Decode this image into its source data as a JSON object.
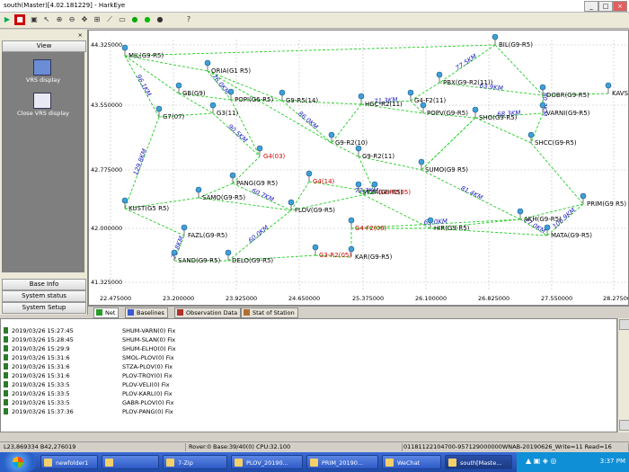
{
  "window": {
    "title": "south(Master)[4.02.181229] - HarkEye"
  },
  "toolbar": {
    "buttons": [
      "play",
      "stop",
      "save",
      "pointer",
      "zoom-in",
      "zoom-out",
      "pan",
      "select",
      "line",
      "open",
      "dot-green",
      "dot-green2",
      "dot-black",
      "help"
    ]
  },
  "left_panel": {
    "header": "View",
    "items": [
      {
        "label": "VRS display",
        "icon": "vrs-display-icon"
      },
      {
        "label": "Close VRS display",
        "icon": "close-vrs-icon"
      }
    ],
    "bottom_buttons": [
      "Base Info",
      "System status",
      "System Setup"
    ]
  },
  "map": {
    "y_ticks": [
      "44.325000",
      "43.550000",
      "42.775000",
      "42.000000",
      "41.325000"
    ],
    "x_ticks": [
      "22.475000",
      "23.200000",
      "23.925000",
      "24.650000",
      "25.375000",
      "26.100000",
      "26.825000",
      "27.550000",
      "28.275000"
    ],
    "stations": [
      {
        "name": "MIL(G9-R5)",
        "color": "#000000"
      },
      {
        "name": "BIL(G9-R5)",
        "color": "#000000"
      },
      {
        "name": "ORIA(G1 R5)",
        "color": "#000000"
      },
      {
        "name": "GB(G9)",
        "color": "#000000"
      },
      {
        "name": "POPI(G6-R5)",
        "color": "#000000"
      },
      {
        "name": "G9-R5(14)",
        "color": "#000000"
      },
      {
        "name": "HGC-R2(11)",
        "color": "#000000"
      },
      {
        "name": "G4-F2(11)",
        "color": "#000000"
      },
      {
        "name": "PBX(G9-R2(11))",
        "color": "#000000"
      },
      {
        "name": "DOBR(G9-R5)",
        "color": "#000000"
      },
      {
        "name": "KAVS(G9)",
        "color": "#000000"
      },
      {
        "name": "POPV(G9-R5)",
        "color": "#000000"
      },
      {
        "name": "SHO(G9-R5)",
        "color": "#000000"
      },
      {
        "name": "VARNI(G9-R5)",
        "color": "#000000"
      },
      {
        "name": "G7(07)",
        "color": "#000000"
      },
      {
        "name": "G3(11)",
        "color": "#000000"
      },
      {
        "name": "G4(03)",
        "color": "#cc0000"
      },
      {
        "name": "G4(14)",
        "color": "#cc0000"
      },
      {
        "name": "G4-R2(05)",
        "color": "#cc0000"
      },
      {
        "name": "G4-F2(06)",
        "color": "#cc0000"
      },
      {
        "name": "G3-R2(05)",
        "color": "#cc0000"
      },
      {
        "name": "PANG(G9 R5)",
        "color": "#000000"
      },
      {
        "name": "SAMO(G9-R5)",
        "color": "#000000"
      },
      {
        "name": "KUST(G5 R5)",
        "color": "#000000"
      },
      {
        "name": "FLOV(G9-R5)",
        "color": "#000000"
      },
      {
        "name": "STZA(G9 R5)",
        "color": "#000000"
      },
      {
        "name": "SUMO(G9 R5)",
        "color": "#000000"
      },
      {
        "name": "HIR(G9-R5)",
        "color": "#000000"
      },
      {
        "name": "AKH(G9-R5)",
        "color": "#000000"
      },
      {
        "name": "PRIM(G9 R5)",
        "color": "#000000"
      },
      {
        "name": "MATA(G9-R5)",
        "color": "#000000"
      },
      {
        "name": "FAZL(G9-R5)",
        "color": "#000000"
      },
      {
        "name": "SAND(G9-R5)",
        "color": "#000000"
      },
      {
        "name": "DELO(G9-R5)",
        "color": "#000000"
      },
      {
        "name": "KAR(G9-R5)",
        "color": "#000000"
      },
      {
        "name": "G9-R2(11)",
        "color": "#000000"
      },
      {
        "name": "G9-R2(10)",
        "color": "#000000"
      },
      {
        "name": "SHCC(G9-R5)",
        "color": "#000000"
      }
    ],
    "distances": [
      "77.5KM",
      "96.1KM",
      "129.8KM",
      "76.0KM",
      "86.0KM",
      "71.3KM",
      "63.9KM",
      "80.3KM",
      "68.3KM",
      "106.9KM",
      "77.0KM",
      "81.4KM",
      "72.2KM",
      "65.0KM",
      "90.5KM",
      "60.0KM",
      "72.8KM",
      "60.7KM"
    ]
  },
  "tabs": [
    {
      "label": "Net",
      "active": true
    },
    {
      "label": "Baselines",
      "active": false
    },
    {
      "label": "Observation Data",
      "active": false
    },
    {
      "label": "Stat of Station",
      "active": false
    }
  ],
  "log": {
    "rows": [
      {
        "time": "2019/03/26 15:27:45",
        "msg": "SHUM-VARN(0) Fix"
      },
      {
        "time": "2019/03/26 15:28:45",
        "msg": "SHUM-SLAN(0) Fix"
      },
      {
        "time": "2019/03/26 15:29:9",
        "msg": "SHUM-ELHO(0) Fix"
      },
      {
        "time": "2019/03/26 15:31:6",
        "msg": "SMOL-PLOV(0) Fix"
      },
      {
        "time": "2019/03/26 15:31:6",
        "msg": "STZA-PLOV(0) Fix"
      },
      {
        "time": "2019/03/26 15:31:6",
        "msg": "PLOV-TROY(0) Fix"
      },
      {
        "time": "2019/03/26 15:33:5",
        "msg": "PLOV-VELI(0) Fix"
      },
      {
        "time": "2019/03/26 15:33:5",
        "msg": "PLOV-KARL(0) Fix"
      },
      {
        "time": "2019/03/26 15:33:5",
        "msg": "GABR-PLOV(0) Fix"
      },
      {
        "time": "2019/03/26 15:37:36",
        "msg": "PLOV-PANG(0) Fix"
      }
    ]
  },
  "status": {
    "coords": "L23,869334 B42,276019",
    "rover": "Rover:0 Base:39/40(0) CPU:32.100",
    "info": "01181122104700-957129000000WNAB-20190626_Write=11 Read=16"
  },
  "taskbar": {
    "start_label": "",
    "tasks": [
      {
        "label": "newfolder1",
        "active": false
      },
      {
        "label": "",
        "active": false
      },
      {
        "label": "7-Zip",
        "active": false
      },
      {
        "label": "PLOV_20190...",
        "active": false
      },
      {
        "label": "PRIM_20190...",
        "active": false
      },
      {
        "label": "WeChat",
        "active": false
      },
      {
        "label": "south[Maste...",
        "active": true
      }
    ],
    "clock": "3:37 PM"
  }
}
